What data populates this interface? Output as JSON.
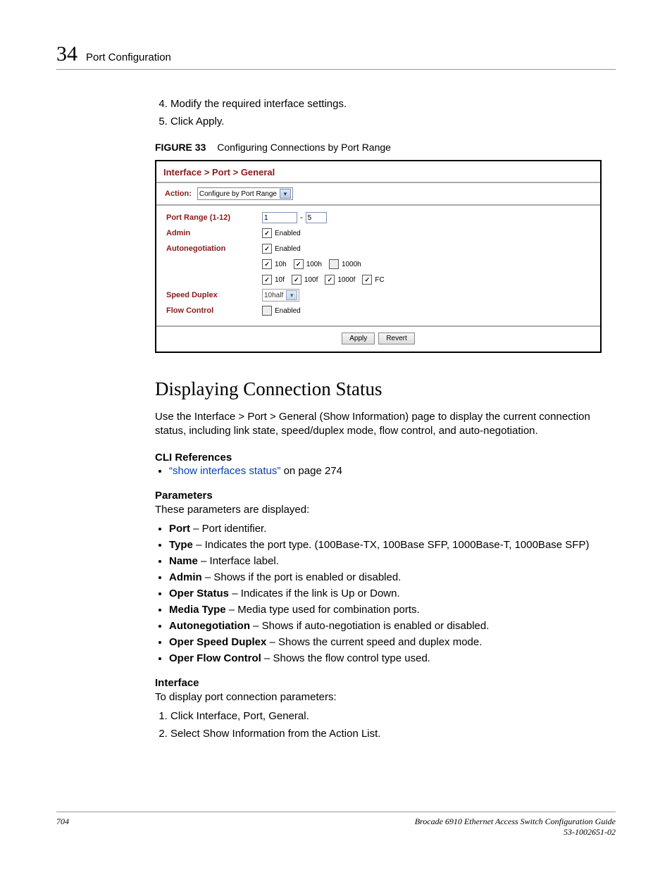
{
  "header": {
    "chapter_number": "34",
    "chapter_title": "Port Configuration"
  },
  "steps_top": {
    "start": 4,
    "items": [
      "Modify the required interface settings.",
      "Click Apply."
    ]
  },
  "figure": {
    "label": "FIGURE 33",
    "caption": "Configuring Connections by Port Range"
  },
  "screenshot": {
    "breadcrumb": "Interface > Port > General",
    "action_label": "Action:",
    "action_value": "Configure by Port Range",
    "rows": {
      "port_range_label": "Port Range (1-12)",
      "port_range_from": "1",
      "port_range_to": "5",
      "admin_label": "Admin",
      "admin_enabled_text": "Enabled",
      "autoneg_label": "Autonegotiation",
      "autoneg_enabled_text": "Enabled",
      "caps_row1": {
        "c10h": "10h",
        "c100h": "100h",
        "c1000h": "1000h"
      },
      "caps_row2": {
        "c10f": "10f",
        "c100f": "100f",
        "c1000f": "1000f",
        "cfc": "FC"
      },
      "speed_duplex_label": "Speed Duplex",
      "speed_duplex_value": "10half",
      "flow_control_label": "Flow Control",
      "flow_control_text": "Enabled"
    },
    "buttons": {
      "apply": "Apply",
      "revert": "Revert"
    }
  },
  "section_title": "Displaying Connection Status",
  "section_intro": "Use the Interface > Port > General (Show Information) page to display the current connection status, including link state, speed/duplex mode, flow control, and auto-negotiation.",
  "cli_refs_label": "CLI References",
  "cli_refs_link": "“show interfaces status”",
  "cli_refs_tail": " on page 274",
  "parameters_label": "Parameters",
  "parameters_intro": "These parameters are displayed:",
  "parameters": [
    {
      "name": "Port",
      "desc": " – Port identifier."
    },
    {
      "name": "Type",
      "desc": " – Indicates the port type. (100Base-TX, 100Base SFP, 1000Base-T, 1000Base SFP)"
    },
    {
      "name": "Name",
      "desc": " – Interface label."
    },
    {
      "name": "Admin",
      "desc": " – Shows if the port is enabled or disabled."
    },
    {
      "name": "Oper Status",
      "desc": " – Indicates if the link is Up or Down."
    },
    {
      "name": "Media Type",
      "desc": " – Media type used for combination ports."
    },
    {
      "name": "Autonegotiation",
      "desc": " – Shows if auto-negotiation is enabled or disabled."
    },
    {
      "name": "Oper Speed Duplex",
      "desc": " – Shows the current speed and duplex mode."
    },
    {
      "name": "Oper Flow Control",
      "desc": " – Shows the flow control type used."
    }
  ],
  "interface_label": "Interface",
  "interface_intro": "To display port connection parameters:",
  "interface_steps": [
    "Click Interface, Port, General.",
    "Select Show Information from the Action List."
  ],
  "footer": {
    "page": "704",
    "book": "Brocade 6910 Ethernet Access Switch Configuration Guide",
    "docnum": "53-1002651-02"
  }
}
